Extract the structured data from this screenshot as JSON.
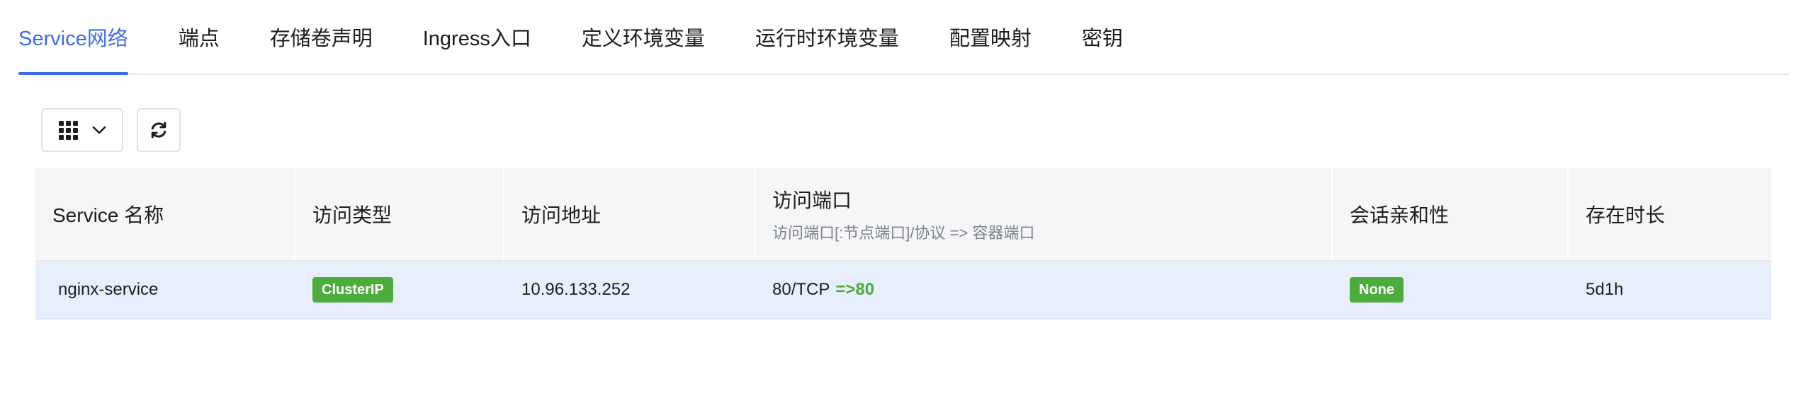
{
  "tabs": [
    {
      "label": "Service网络",
      "active": true
    },
    {
      "label": "端点"
    },
    {
      "label": "存储卷声明"
    },
    {
      "label": "Ingress入口"
    },
    {
      "label": "定义环境变量"
    },
    {
      "label": "运行时环境变量"
    },
    {
      "label": "配置映射"
    },
    {
      "label": "密钥"
    }
  ],
  "toolbar": {
    "columns_icon": "grid-icon",
    "dropdown_icon": "chevron-down-icon",
    "refresh_icon": "refresh-icon"
  },
  "table": {
    "headers": {
      "name": "Service 名称",
      "type": "访问类型",
      "address": "访问地址",
      "port": "访问端口",
      "port_sub": "访问端口[:节点端口]/协议 => 容器端口",
      "affinity": "会话亲和性",
      "age": "存在时长"
    },
    "rows": [
      {
        "name": "nginx-service",
        "type": "ClusterIP",
        "address": "10.96.133.252",
        "port": "80/TCP",
        "target": "=>80",
        "affinity": "None",
        "age": "5d1h"
      }
    ]
  },
  "colors": {
    "accent": "#3b6ee6",
    "badge_green": "#4cad3c",
    "selected_row": "#e8effc"
  }
}
